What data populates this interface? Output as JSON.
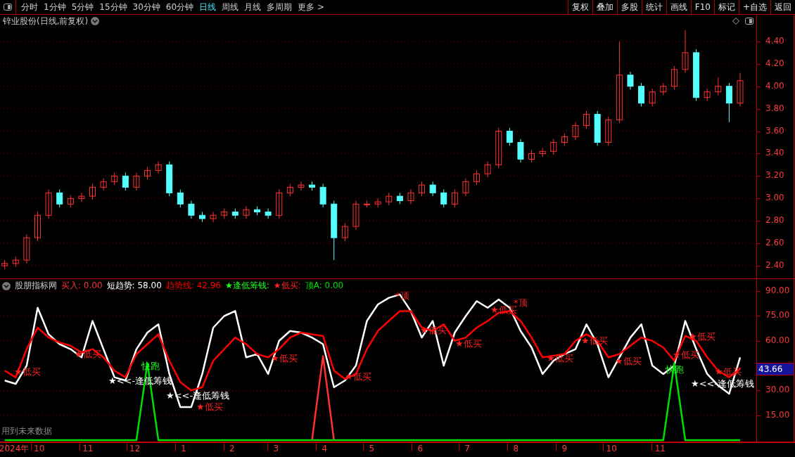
{
  "toolbar": {
    "periods": [
      {
        "label": "分时",
        "selected": false
      },
      {
        "label": "1分钟",
        "selected": false
      },
      {
        "label": "5分钟",
        "selected": false
      },
      {
        "label": "15分钟",
        "selected": false
      },
      {
        "label": "30分钟",
        "selected": false
      },
      {
        "label": "60分钟",
        "selected": false
      },
      {
        "label": "日线",
        "selected": true
      },
      {
        "label": "周线",
        "selected": false
      },
      {
        "label": "月线",
        "selected": false
      },
      {
        "label": "多周期",
        "selected": false
      },
      {
        "label": "更多 >",
        "selected": false
      }
    ],
    "buttons": [
      "复权",
      "叠加",
      "多股",
      "统计",
      "画线",
      "F10",
      "标记",
      "+自选",
      "返回"
    ]
  },
  "chart_title": "锌业股份(日线,前复权)",
  "price_chart": {
    "chart_data": {
      "type": "candlestick",
      "grid": true,
      "xlim": [
        "2024-09-06",
        "2026-01-26"
      ],
      "ylim": [
        2.287,
        4.525
      ],
      "yticks": [
        {
          "value": 2.4,
          "label": "2.40"
        },
        {
          "value": 2.6,
          "label": "2.60"
        },
        {
          "value": 2.8,
          "label": "2.80"
        },
        {
          "value": 3.0,
          "label": "3.00"
        },
        {
          "value": 3.2,
          "label": "3.20"
        },
        {
          "value": 3.4,
          "label": "3.40"
        },
        {
          "value": 3.6,
          "label": "3.60"
        },
        {
          "value": 3.8,
          "label": "3.80"
        },
        {
          "value": 4.0,
          "label": "4.00"
        },
        {
          "value": 4.2,
          "label": "4.20"
        },
        {
          "value": 4.4,
          "label": "4.40"
        }
      ],
      "x": [
        "2024-09-09",
        "2024-09-16",
        "2024-09-23",
        "2024-09-30",
        "2024-10-07",
        "2024-10-14",
        "2024-10-21",
        "2024-10-28",
        "2024-11-04",
        "2024-11-11",
        "2024-11-18",
        "2024-11-25",
        "2024-12-02",
        "2024-12-09",
        "2024-12-16",
        "2024-12-23",
        "2024-12-30",
        "2025-01-06",
        "2025-01-13",
        "2025-01-20",
        "2025-01-27",
        "2025-02-03",
        "2025-02-10",
        "2025-02-17",
        "2025-02-24",
        "2025-03-03",
        "2025-03-10",
        "2025-03-17",
        "2025-03-24",
        "2025-03-31",
        "2025-04-07",
        "2025-04-14",
        "2025-04-21",
        "2025-04-28",
        "2025-05-05",
        "2025-05-12",
        "2025-05-19",
        "2025-05-26",
        "2025-06-02",
        "2025-06-09",
        "2025-06-16",
        "2025-06-23",
        "2025-06-30",
        "2025-07-07",
        "2025-07-14",
        "2025-07-21",
        "2025-07-28",
        "2025-08-04",
        "2025-08-11",
        "2025-08-18",
        "2025-08-25",
        "2025-09-01",
        "2025-09-08",
        "2025-09-15",
        "2025-09-22",
        "2025-09-29",
        "2025-10-06",
        "2025-10-13",
        "2025-10-20",
        "2025-10-27",
        "2025-11-03",
        "2025-11-10",
        "2025-11-17",
        "2025-11-24",
        "2025-12-01",
        "2025-12-08",
        "2025-12-15",
        "2025-12-22"
      ],
      "ohlc": [
        [
          2.4,
          2.45,
          2.37,
          2.42
        ],
        [
          2.42,
          2.48,
          2.39,
          2.45
        ],
        [
          2.45,
          2.68,
          2.42,
          2.65
        ],
        [
          2.65,
          2.88,
          2.62,
          2.85
        ],
        [
          2.85,
          3.08,
          2.82,
          3.05
        ],
        [
          3.05,
          3.08,
          2.92,
          2.95
        ],
        [
          2.95,
          3.03,
          2.92,
          3.0
        ],
        [
          3.0,
          3.05,
          2.97,
          3.02
        ],
        [
          3.02,
          3.13,
          2.99,
          3.1
        ],
        [
          3.1,
          3.18,
          3.07,
          3.15
        ],
        [
          3.15,
          3.23,
          3.12,
          3.2
        ],
        [
          3.2,
          3.23,
          3.07,
          3.1
        ],
        [
          3.1,
          3.23,
          3.07,
          3.2
        ],
        [
          3.2,
          3.28,
          3.17,
          3.25
        ],
        [
          3.25,
          3.33,
          3.22,
          3.3
        ],
        [
          3.3,
          3.33,
          3.02,
          3.05
        ],
        [
          3.05,
          3.08,
          2.92,
          2.95
        ],
        [
          2.95,
          2.98,
          2.82,
          2.85
        ],
        [
          2.85,
          2.88,
          2.79,
          2.82
        ],
        [
          2.82,
          2.88,
          2.79,
          2.85
        ],
        [
          2.85,
          2.91,
          2.82,
          2.88
        ],
        [
          2.88,
          2.91,
          2.82,
          2.85
        ],
        [
          2.85,
          2.93,
          2.82,
          2.9
        ],
        [
          2.9,
          2.93,
          2.85,
          2.88
        ],
        [
          2.88,
          2.91,
          2.82,
          2.85
        ],
        [
          2.85,
          3.08,
          2.82,
          3.05
        ],
        [
          3.05,
          3.13,
          3.02,
          3.1
        ],
        [
          3.1,
          3.15,
          3.07,
          3.12
        ],
        [
          3.12,
          3.15,
          3.07,
          3.1
        ],
        [
          3.1,
          3.13,
          2.92,
          2.95
        ],
        [
          2.95,
          2.98,
          2.45,
          2.65
        ],
        [
          2.65,
          2.78,
          2.62,
          2.75
        ],
        [
          2.75,
          2.98,
          2.72,
          2.95
        ],
        [
          2.95,
          2.98,
          2.92,
          2.95
        ],
        [
          2.95,
          3.0,
          2.92,
          2.97
        ],
        [
          2.97,
          3.05,
          2.94,
          3.02
        ],
        [
          3.02,
          3.05,
          2.95,
          2.98
        ],
        [
          2.98,
          3.08,
          2.95,
          3.05
        ],
        [
          3.05,
          3.15,
          3.02,
          3.12
        ],
        [
          3.12,
          3.15,
          3.02,
          3.05
        ],
        [
          3.05,
          3.08,
          2.92,
          2.95
        ],
        [
          2.95,
          3.08,
          2.92,
          3.05
        ],
        [
          3.05,
          3.18,
          3.02,
          3.15
        ],
        [
          3.15,
          3.25,
          3.12,
          3.22
        ],
        [
          3.22,
          3.33,
          3.19,
          3.3
        ],
        [
          3.3,
          3.63,
          3.27,
          3.6
        ],
        [
          3.6,
          3.63,
          3.47,
          3.5
        ],
        [
          3.5,
          3.53,
          3.32,
          3.35
        ],
        [
          3.35,
          3.43,
          3.32,
          3.4
        ],
        [
          3.4,
          3.45,
          3.37,
          3.42
        ],
        [
          3.42,
          3.53,
          3.39,
          3.5
        ],
        [
          3.5,
          3.58,
          3.47,
          3.55
        ],
        [
          3.55,
          3.68,
          3.52,
          3.65
        ],
        [
          3.65,
          3.78,
          3.62,
          3.75
        ],
        [
          3.75,
          3.78,
          3.47,
          3.5
        ],
        [
          3.5,
          3.73,
          3.47,
          3.7
        ],
        [
          3.7,
          4.4,
          3.67,
          4.1
        ],
        [
          4.1,
          4.13,
          3.97,
          4.0
        ],
        [
          4.0,
          4.03,
          3.82,
          3.85
        ],
        [
          3.85,
          3.98,
          3.82,
          3.95
        ],
        [
          3.95,
          4.03,
          3.92,
          4.0
        ],
        [
          4.0,
          4.18,
          3.97,
          4.15
        ],
        [
          4.15,
          4.5,
          4.12,
          4.3
        ],
        [
          4.3,
          4.33,
          3.87,
          3.9
        ],
        [
          3.9,
          3.98,
          3.87,
          3.95
        ],
        [
          3.95,
          4.08,
          3.92,
          4.0
        ],
        [
          4.0,
          4.03,
          3.68,
          3.85
        ],
        [
          3.85,
          4.12,
          3.82,
          4.05
        ]
      ]
    }
  },
  "indicator": {
    "name": "股朋指标网",
    "legend_extras": [
      {
        "label": "★逢低筹钱:",
        "color": "#20ff20"
      },
      {
        "label": "★低买:",
        "color": "#ff2020"
      }
    ],
    "note": "用到未来数据",
    "current_value": "43.66",
    "chart_data": {
      "type": "line",
      "grid": true,
      "xlim": [
        "2024-09-06",
        "2026-01-26"
      ],
      "ylim": [
        -0.85,
        97.3
      ],
      "yticks": [
        {
          "value": 15,
          "label": "15.00"
        },
        {
          "value": 30,
          "label": "30.00"
        },
        {
          "value": 60,
          "label": "60.00"
        },
        {
          "value": 75,
          "label": "75.00"
        },
        {
          "value": 90,
          "label": "90.00"
        }
      ],
      "xticks": [
        {
          "value": "2024-09-15",
          "label": "2024年"
        },
        {
          "value": "2024-10-01",
          "label": "10"
        },
        {
          "value": "2024-11-01",
          "label": "11"
        },
        {
          "value": "2024-12-01",
          "label": "12"
        },
        {
          "value": "2025-01-01",
          "label": "1"
        },
        {
          "value": "2025-02-01",
          "label": "2"
        },
        {
          "value": "2025-03-01",
          "label": "3"
        },
        {
          "value": "2025-04-01",
          "label": "4"
        },
        {
          "value": "2025-05-01",
          "label": "5"
        },
        {
          "value": "2025-06-01",
          "label": "6"
        },
        {
          "value": "2025-07-01",
          "label": "7"
        },
        {
          "value": "2025-08-01",
          "label": "8"
        },
        {
          "value": "2025-09-01",
          "label": "9"
        },
        {
          "value": "2025-10-01",
          "label": "10"
        },
        {
          "value": "2025-11-01",
          "label": "11"
        }
      ],
      "x": [
        "2024-09-09",
        "2024-09-16",
        "2024-09-23",
        "2024-09-30",
        "2024-10-07",
        "2024-10-14",
        "2024-10-21",
        "2024-10-28",
        "2024-11-04",
        "2024-11-11",
        "2024-11-18",
        "2024-11-25",
        "2024-12-02",
        "2024-12-09",
        "2024-12-16",
        "2024-12-23",
        "2024-12-30",
        "2025-01-06",
        "2025-01-13",
        "2025-01-20",
        "2025-01-27",
        "2025-02-03",
        "2025-02-10",
        "2025-02-17",
        "2025-02-24",
        "2025-03-03",
        "2025-03-10",
        "2025-03-17",
        "2025-03-24",
        "2025-03-31",
        "2025-04-07",
        "2025-04-14",
        "2025-04-21",
        "2025-04-28",
        "2025-05-05",
        "2025-05-12",
        "2025-05-19",
        "2025-05-26",
        "2025-06-02",
        "2025-06-09",
        "2025-06-16",
        "2025-06-23",
        "2025-06-30",
        "2025-07-07",
        "2025-07-14",
        "2025-07-21",
        "2025-07-28",
        "2025-08-04",
        "2025-08-11",
        "2025-08-18",
        "2025-08-25",
        "2025-09-01",
        "2025-09-08",
        "2025-09-15",
        "2025-09-22",
        "2025-09-29",
        "2025-10-06",
        "2025-10-13",
        "2025-10-20",
        "2025-10-27",
        "2025-11-03",
        "2025-11-10",
        "2025-11-17",
        "2025-11-24",
        "2025-12-01",
        "2025-12-08",
        "2025-12-15",
        "2025-12-22"
      ],
      "series": [
        {
          "name": "买入: 0.00",
          "color": "#ff3030",
          "values": [
            null,
            null,
            null,
            null,
            null,
            null,
            null,
            null,
            null,
            null,
            null,
            null,
            null,
            null,
            null,
            null,
            null,
            null,
            null,
            null,
            null,
            null,
            null,
            null,
            null,
            null,
            null,
            null,
            0,
            50.8,
            0,
            null,
            null,
            null,
            null,
            null,
            null,
            null,
            null,
            null,
            null,
            null,
            null,
            null,
            null,
            null,
            null,
            null,
            null,
            null,
            null,
            null,
            null,
            null,
            null,
            null,
            null,
            null,
            null,
            null,
            null,
            null,
            null,
            null,
            null,
            null,
            null,
            null
          ]
        },
        {
          "name": "短趋势: 58.00",
          "color": "#ffffff",
          "values": [
            36,
            34,
            45,
            80,
            64,
            58,
            55,
            50,
            72,
            55,
            38,
            36,
            55,
            65,
            70,
            40,
            20,
            20,
            40,
            68,
            75,
            78,
            50,
            52,
            40,
            60,
            66,
            65,
            62,
            58,
            32,
            36,
            45,
            72,
            82,
            86,
            88,
            78,
            62,
            72,
            45,
            65,
            75,
            84,
            80,
            85,
            80,
            66,
            56,
            40,
            48,
            52,
            55,
            70,
            58,
            38,
            50,
            62,
            70,
            45,
            40,
            45,
            72,
            55,
            40,
            33,
            28,
            50
          ]
        },
        {
          "name": "趋势线: 42.96",
          "color": "#ff0000",
          "values": [
            42,
            38,
            55,
            68,
            62,
            59,
            57,
            53,
            55,
            50,
            42,
            38,
            52,
            58,
            64,
            48,
            35,
            30,
            32,
            48,
            55,
            62,
            58,
            52,
            50,
            55,
            62,
            65,
            64,
            63,
            42,
            37,
            40,
            55,
            66,
            72,
            78,
            78,
            68,
            66,
            70,
            60,
            62,
            68,
            72,
            77,
            78,
            72,
            62,
            50,
            51,
            52,
            60,
            64,
            60,
            50,
            52,
            57,
            62,
            60,
            56,
            48,
            63,
            60,
            50,
            42,
            38,
            43
          ]
        },
        {
          "name": "顶A: 0.00",
          "color": "#00e000",
          "values": [
            0,
            0,
            0,
            0,
            0,
            0,
            0,
            0,
            0,
            0,
            0,
            0,
            0,
            46.5,
            0,
            0,
            0,
            0,
            0,
            0,
            0,
            0,
            0,
            0,
            0,
            0,
            0,
            0,
            0,
            0,
            0,
            0,
            0,
            0,
            0,
            0,
            0,
            0,
            0,
            0,
            0,
            0,
            0,
            0,
            0,
            0,
            0,
            0,
            0,
            0,
            0,
            0,
            0,
            0,
            0,
            0,
            0,
            0,
            0,
            0,
            0,
            46.5,
            0,
            0,
            0,
            0,
            0,
            0
          ]
        }
      ]
    },
    "signals": [
      {
        "text": "★低买",
        "color": "#ff2020"
      },
      {
        "text": "★低买",
        "color": "#ff2020"
      },
      {
        "text": "快跑",
        "color": "#20ff20"
      },
      {
        "text": "★<<-逢低筹钱",
        "color": "#ffffff"
      },
      {
        "text": "★<<-逢低筹钱",
        "color": "#ffffff"
      },
      {
        "text": "★低买",
        "color": "#ff2020"
      },
      {
        "text": "★低买",
        "color": "#ff2020"
      },
      {
        "text": "★低买",
        "color": "#ff2020"
      },
      {
        "text": "*顶",
        "color": "#ff2020"
      },
      {
        "text": "★低买",
        "color": "#ff2020"
      },
      {
        "text": "★低买",
        "color": "#ff2020"
      },
      {
        "text": "★低买",
        "color": "#ff2020"
      },
      {
        "text": "*顶",
        "color": "#ff2020"
      },
      {
        "text": "★低买",
        "color": "#ff2020"
      },
      {
        "text": "★低买",
        "color": "#ff2020"
      },
      {
        "text": "★低买",
        "color": "#ff2020"
      },
      {
        "text": "★低买",
        "color": "#ff2020"
      },
      {
        "text": "快跑",
        "color": "#20ff20"
      },
      {
        "text": "★低买",
        "color": "#ff2020"
      },
      {
        "text": "★低买",
        "color": "#ff2020"
      },
      {
        "text": "★<<-逢低筹钱",
        "color": "#ffffff"
      }
    ]
  }
}
